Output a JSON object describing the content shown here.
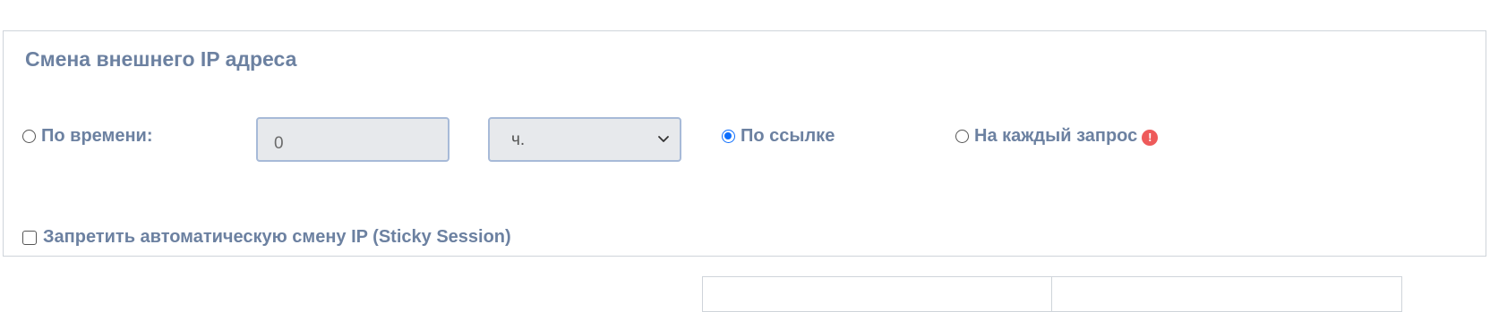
{
  "panel": {
    "title": "Смена внешнего IP адреса"
  },
  "ip_change": {
    "options": [
      {
        "label": "По времени:",
        "checked": false
      },
      {
        "label": "По ссылке",
        "checked": true
      },
      {
        "label": "На каждый запрос",
        "checked": false
      }
    ],
    "time_value": "0",
    "unit_selected": "ч.",
    "warning_icon": "exclamation-circle-icon"
  },
  "sticky": {
    "label": "Запретить автоматическую смену IP (Sticky Session)",
    "checked": false
  },
  "colors": {
    "label": "#6c81a1",
    "accent": "#0d6efd",
    "warning": "#ee5a5a",
    "input_border": "#a7bad8",
    "input_bg": "#e7e9ec"
  }
}
